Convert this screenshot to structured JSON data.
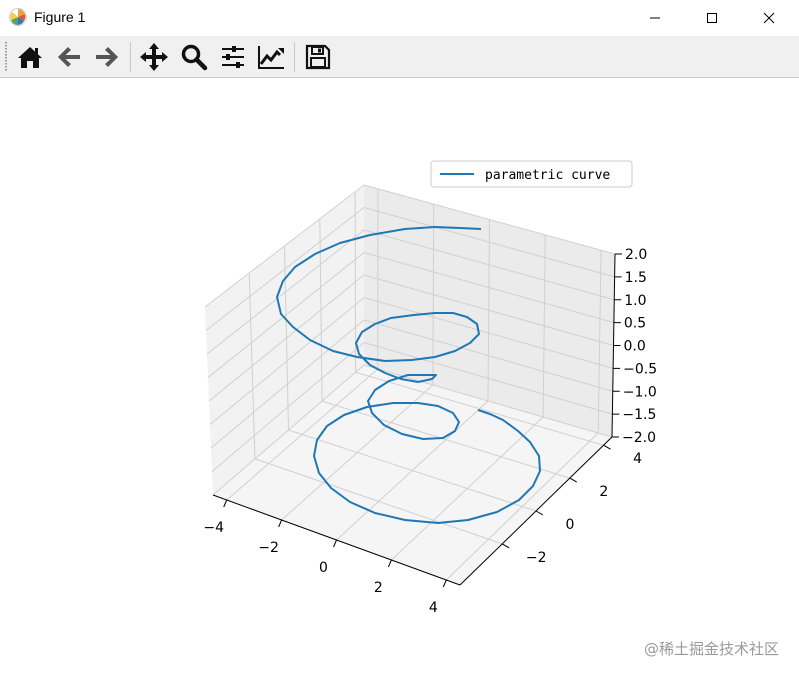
{
  "window": {
    "title": "Figure 1",
    "app_icon": "matplotlib-logo-icon",
    "controls": [
      "minimize-icon",
      "maximize-icon",
      "close-icon"
    ]
  },
  "toolbar": {
    "buttons": [
      "home-icon",
      "back-arrow-icon",
      "forward-arrow-icon",
      "pan-move-icon",
      "zoom-magnifier-icon",
      "subplots-sliders-icon",
      "edit-axis-curve-icon",
      "save-floppy-icon"
    ]
  },
  "watermark": "@稀土掘金技术社区",
  "chart_data": {
    "type": "line",
    "projection": "3d",
    "legend": {
      "entries": [
        "parametric curve"
      ],
      "placement": "upper-right"
    },
    "series": [
      {
        "name": "parametric curve",
        "color": "#1f77b4",
        "curve": "parametric spiral (radius shrinks then grows with z)"
      }
    ],
    "x_ticks": [
      "−4",
      "−2",
      "0",
      "2",
      "4"
    ],
    "y_ticks": [
      "−2",
      "0",
      "2",
      "4"
    ],
    "z_ticks": [
      "−2.0",
      "−1.5",
      "−1.0",
      "−0.5",
      "0.0",
      "0.5",
      "1.0",
      "1.5",
      "2.0"
    ],
    "xlim": [
      -4.5,
      4.5
    ],
    "ylim": [
      -4.5,
      4.5
    ],
    "zlim": [
      -2,
      2
    ],
    "grid": true
  }
}
